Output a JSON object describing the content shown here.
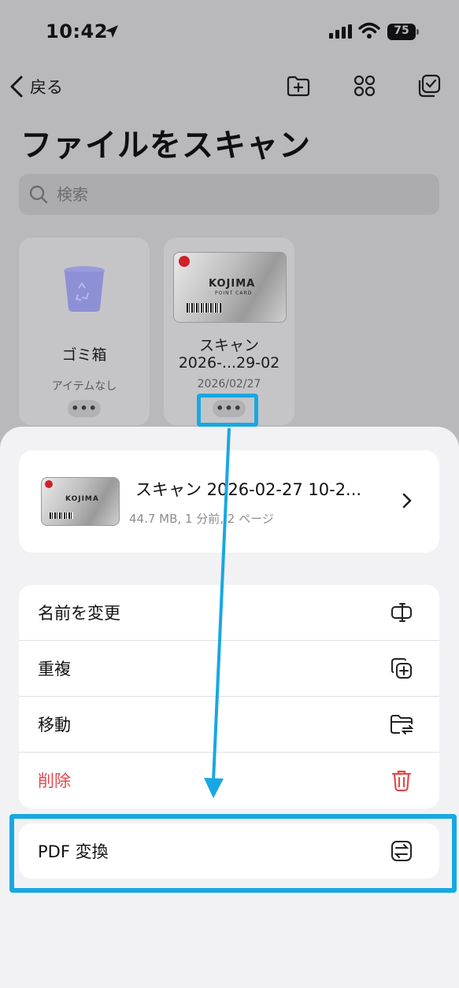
{
  "status_bar": {
    "time": "10:42",
    "battery": "75"
  },
  "nav": {
    "back_label": "戻る"
  },
  "page": {
    "title": "ファイルをスキャン"
  },
  "search": {
    "placeholder": "検索"
  },
  "tiles": [
    {
      "name": "ゴミ箱",
      "subtitle": "アイテムなし"
    },
    {
      "name_line1": "スキャン",
      "name_line2": "2026-...29-02",
      "subtitle": "2026/02/27"
    }
  ],
  "thumbnail_text": {
    "brand": "KOJIMA",
    "sub": "POINT CARD"
  },
  "sheet": {
    "file_title": "スキャン 2026-02-27 10-2...",
    "file_meta": "44.7 MB, 1 分前, 2 ページ",
    "menu": [
      {
        "label": "名前を変更",
        "icon": "rename-icon"
      },
      {
        "label": "重複",
        "icon": "duplicate-icon"
      },
      {
        "label": "移動",
        "icon": "move-folder-icon"
      },
      {
        "label": "削除",
        "icon": "trash-icon",
        "color": "#e5484d"
      }
    ],
    "pdf_item": {
      "label": "PDF 変換",
      "icon": "convert-icon"
    }
  },
  "colors": {
    "highlight": "#17a8e3",
    "danger": "#e5484d"
  }
}
